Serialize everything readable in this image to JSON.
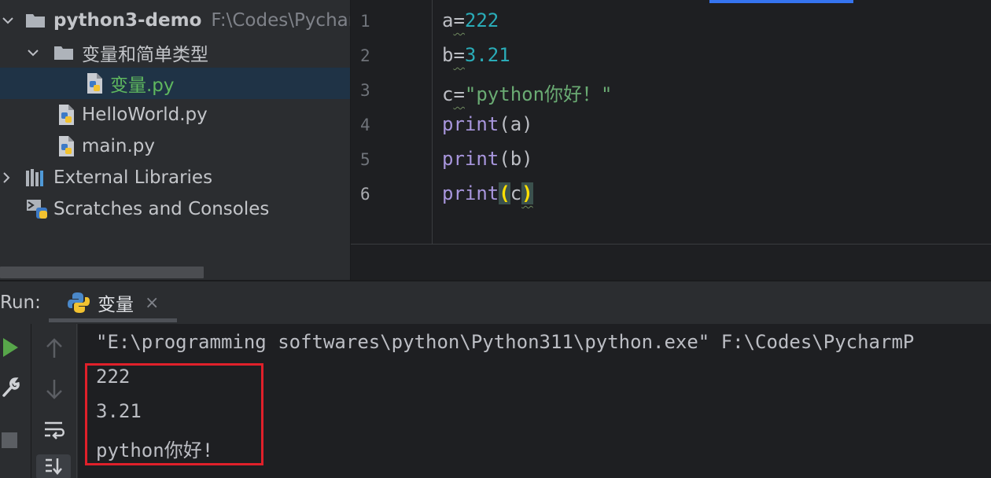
{
  "project_tree": {
    "items": [
      {
        "label": "python3-demo",
        "path": "F:\\Codes\\Pycharm"
      },
      {
        "label": "变量和简单类型"
      },
      {
        "label": "变量.py"
      },
      {
        "label": "HelloWorld.py"
      },
      {
        "label": "main.py"
      },
      {
        "label": "External Libraries"
      },
      {
        "label": "Scratches and Consoles"
      }
    ]
  },
  "editor": {
    "line_numbers": [
      "1",
      "2",
      "3",
      "4",
      "5",
      "6"
    ],
    "lines": [
      {
        "a": "a",
        "b": "=",
        "c": "222"
      },
      {
        "a": "b",
        "b": "=",
        "c": "3.21"
      },
      {
        "a": "c",
        "b": "=",
        "c": "\"python你好！\""
      },
      {
        "a": "print",
        "b": "(a)"
      },
      {
        "a": "print",
        "b": "(b)"
      },
      {
        "a": "print",
        "b": "(",
        "c": "c",
        "d": ")"
      }
    ]
  },
  "run_panel": {
    "title": "Run:",
    "tab_label": "变量",
    "tab_close": "×",
    "console_lines": [
      "\"E:\\programming softwares\\python\\Python311\\python.exe\" F:\\Codes\\PycharmP",
      "222",
      "3.21",
      "python你好!"
    ]
  },
  "colors": {
    "accent": "#3574f0",
    "highlight_box": "#e0202a",
    "string": "#6aab73",
    "number": "#2aacb8",
    "builtin": "#a896dd"
  },
  "icons": [
    "chevron-down-icon",
    "chevron-right-icon",
    "folder-icon",
    "python-file-icon",
    "library-icon",
    "scratches-icon",
    "python-icon",
    "run-icon",
    "up-arrow-icon",
    "down-arrow-icon",
    "wrench-icon",
    "stop-icon",
    "soft-wrap-icon",
    "scroll-to-end-icon"
  ]
}
